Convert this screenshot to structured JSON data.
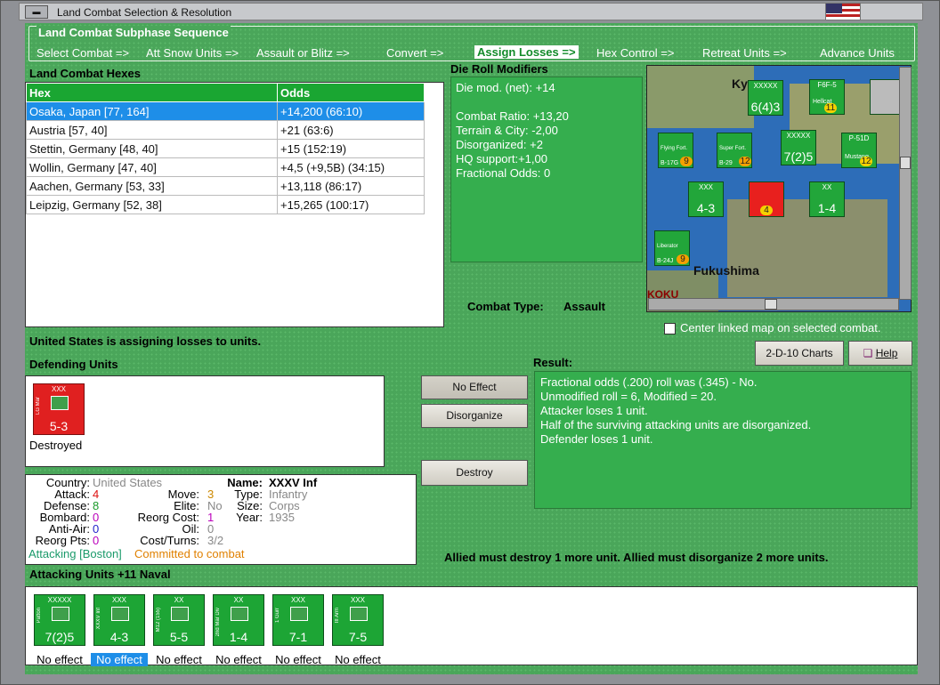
{
  "window": {
    "title": "Land Combat Selection & Resolution",
    "menu_icon": "window-menu-icon"
  },
  "subphase": {
    "caption": "Land Combat Subphase Sequence",
    "steps": [
      "Select Combat =>",
      "Att Snow Units =>",
      "Assault or Blitz =>",
      "Convert =>",
      "Assign Losses =>",
      "Hex Control =>",
      "Retreat Units =>",
      "Advance Units"
    ],
    "active": "Assign Losses =>"
  },
  "hexes": {
    "caption": "Land Combat Hexes",
    "columns": [
      "Hex",
      "Odds"
    ],
    "rows": [
      {
        "hex": "Osaka, Japan [77, 164]",
        "odds": "+14,200 (66:10)"
      },
      {
        "hex": "Austria [57, 40]",
        "odds": "+21 (63:6)"
      },
      {
        "hex": "Stettin, Germany [48, 40]",
        "odds": "+15 (152:19)"
      },
      {
        "hex": "Wollin, Germany [47, 40]",
        "odds": "+4,5 (+9,5B) (34:15)"
      },
      {
        "hex": "Aachen, Germany [53, 33]",
        "odds": "+13,118 (86:17)"
      },
      {
        "hex": "Leipzig, Germany [52, 38]",
        "odds": "+15,265 (100:17)"
      }
    ]
  },
  "modifiers": {
    "caption": "Die Roll Modifiers",
    "lines": [
      "Die mod. (net): +14",
      "",
      "Combat Ratio: +13,20",
      "Terrain & City: -2,00",
      "Disorganized: +2",
      "HQ support:+1,00",
      "Fractional Odds: 0"
    ]
  },
  "map": {
    "labels": {
      "kyoto": "Ky",
      "fukushima": "Fukushima",
      "koku": "KOKU"
    },
    "units": [
      {
        "top": "XXXXX",
        "value": "6(4)3"
      },
      {
        "top": "P-51D",
        "value": "12",
        "name": "Mustang"
      },
      {
        "top": "B-17G",
        "value": "9",
        "name": "Flying Fort."
      },
      {
        "top": "B-29",
        "value": "12",
        "name": "Super Fort."
      },
      {
        "top": "XXXXX",
        "value": "7(2)5"
      },
      {
        "top": "XX",
        "value": "1-4"
      },
      {
        "top": "XXX",
        "value": "4-3"
      },
      {
        "top": "B-24J",
        "value": "9",
        "name": "Liberator"
      },
      {
        "top": "F6F-5",
        "value": "11",
        "name": "Hellcat"
      }
    ]
  },
  "combat_type": {
    "label": "Combat Type:",
    "value": "Assault"
  },
  "center_map": {
    "label": "Center linked map on selected combat.",
    "checked": false
  },
  "status_line": "United States is assigning losses to units.",
  "buttons": {
    "charts": "2-D-10 Charts",
    "help": "Help",
    "no_effect": "No Effect",
    "disorganize": "Disorganize",
    "destroy": "Destroy"
  },
  "defending": {
    "caption": "Defending Units",
    "units": [
      {
        "side": "LG Mar",
        "size": "XXX",
        "value": "5-3",
        "status": "Destroyed"
      }
    ]
  },
  "info": {
    "country": {
      "label": "Country:",
      "value": "United States"
    },
    "attack": {
      "label": "Attack:",
      "value": "4"
    },
    "defense": {
      "label": "Defense:",
      "value": "8"
    },
    "bombard": {
      "label": "Bombard:",
      "value": "0"
    },
    "anti_air": {
      "label": "Anti-Air:",
      "value": "0"
    },
    "reorg_pts": {
      "label": "Reorg Pts:",
      "value": "0"
    },
    "move": {
      "label": "Move:",
      "value": "3"
    },
    "elite": {
      "label": "Elite:",
      "value": "No"
    },
    "reorg_cost": {
      "label": "Reorg Cost:",
      "value": "1"
    },
    "oil": {
      "label": "Oil:",
      "value": "0"
    },
    "cost_turns": {
      "label": "Cost/Turns:",
      "value": "3/2"
    },
    "name": {
      "label": "Name:",
      "value": "XXXV Inf"
    },
    "type": {
      "label": "Type:",
      "value": "Infantry"
    },
    "size": {
      "label": "Size:",
      "value": "Corps"
    },
    "year": {
      "label": "Year:",
      "value": "1935"
    },
    "attacking": "Attacking [Boston]",
    "committed": "Committed to combat"
  },
  "result": {
    "caption": "Result:",
    "lines": [
      "Fractional odds (.200) roll was (.345)  - No.",
      "Unmodified roll = 6, Modified = 20.",
      "Attacker loses 1 unit.",
      "Half of the surviving attacking units are disorganized.",
      "Defender loses 1 unit."
    ]
  },
  "losses_msg": "Allied must destroy 1 more unit. Allied must disorganize 2 more units.",
  "attacking": {
    "caption": "Attacking Units +11 Naval",
    "units": [
      {
        "side": "Patton",
        "size": "XXXXX",
        "value": "7(2)5",
        "status": "No effect"
      },
      {
        "side": "XXXV Inf",
        "size": "XXX",
        "value": "4-3",
        "status": "No effect"
      },
      {
        "side": "M12 (155)",
        "size": "XX",
        "value": "5-5",
        "status": "No effect"
      },
      {
        "side": "2nd Mar Div",
        "size": "XX",
        "value": "1-4",
        "status": "No effect"
      },
      {
        "side": "1 Gurr",
        "size": "XXX",
        "value": "7-1",
        "status": "No effect"
      },
      {
        "side": "III Arm",
        "size": "XXX",
        "value": "7-5",
        "status": "No effect"
      }
    ],
    "selected_index": 1
  },
  "colors": {
    "panel_green": "#35ae4e",
    "header_green": "#1aa632",
    "selection_blue": "#1e8ee8",
    "attack_red": "#e02020"
  }
}
